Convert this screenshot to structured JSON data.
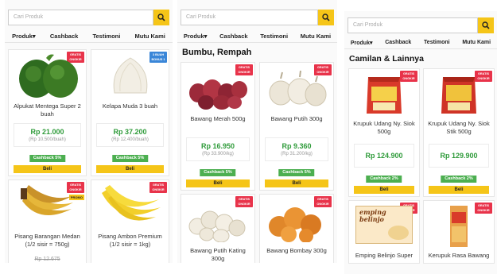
{
  "search": {
    "placeholder": "Cari Produk",
    "placeholder_alt": "Cari Produk"
  },
  "nav": [
    "Produk",
    "Cashback",
    "Testimoni",
    "Mutu Kami"
  ],
  "colors": {
    "accent": "#f5c518",
    "price": "#2f9b3a",
    "cashback": "#4caf50",
    "badge": "#e8334a",
    "badge_blue": "#3a86d8"
  },
  "panel1": {
    "cards": [
      {
        "name": "Alpukat Mentega Super 2 buah",
        "price": "Rp 21.000",
        "unit": "(Rp 10.500/buah)",
        "cashback": "Cashback 5%",
        "buy": "Beli",
        "badge": "GRATIS ONGKIR"
      },
      {
        "name": "Kelapa Muda 3 buah",
        "price": "Rp 37.200",
        "unit": "(Rp 12.400/buah)",
        "cashback": "Cashback 5%",
        "buy": "Beli",
        "badge": "3 BUAH BONUS 1 BUAH"
      },
      {
        "name": "Pisang Barangan Medan (1/2 sisir = 750g)",
        "price": "Rp 12.675",
        "badge": "GRATIS ONGKIR",
        "promo": "PROMO"
      },
      {
        "name": "Pisang Ambon Premium (1/2 sisir = 1kg)",
        "badge": "GRATIS ONGKIR"
      }
    ]
  },
  "panel2": {
    "section": "Bumbu, Rempah",
    "cards": [
      {
        "name": "Bawang Merah 500g",
        "price": "Rp 16.950",
        "unit": "(Rp 33.900/kg)",
        "cashback": "Cashback 5%",
        "buy": "Beli",
        "badge": "GRATIS ONGKIR"
      },
      {
        "name": "Bawang Putih 300g",
        "price": "Rp 9.360",
        "unit": "(Rp 31.200/kg)",
        "cashback": "Cashback 5%",
        "buy": "Beli",
        "badge": "GRATIS ONGKIR"
      },
      {
        "name": "Bawang Putih Kating 300g",
        "badge": "GRATIS ONGKIR"
      },
      {
        "name": "Bawang Bombay 300g",
        "badge": "GRATIS ONGKIR"
      }
    ]
  },
  "panel3": {
    "section": "Camilan & Lainnya",
    "cards": [
      {
        "name": "Krupuk Udang Ny. Siok 500g",
        "price": "Rp 124.900",
        "cashback": "Cashback 2%",
        "buy": "Beli",
        "badge": "GRATIS ONGKIR"
      },
      {
        "name": "Krupuk Udang Ny. Siok Stik 500g",
        "price": "Rp 129.900",
        "cashback": "Cashback 2%",
        "buy": "Beli",
        "badge": "GRATIS ONGKIR"
      },
      {
        "name": "Emping Belinjo Super",
        "badge": "GRATIS ONGKIR",
        "label": "emping belinjo"
      },
      {
        "name": "Kerupuk Rasa Bawang",
        "badge": "GRATIS ONGKIR"
      }
    ]
  }
}
